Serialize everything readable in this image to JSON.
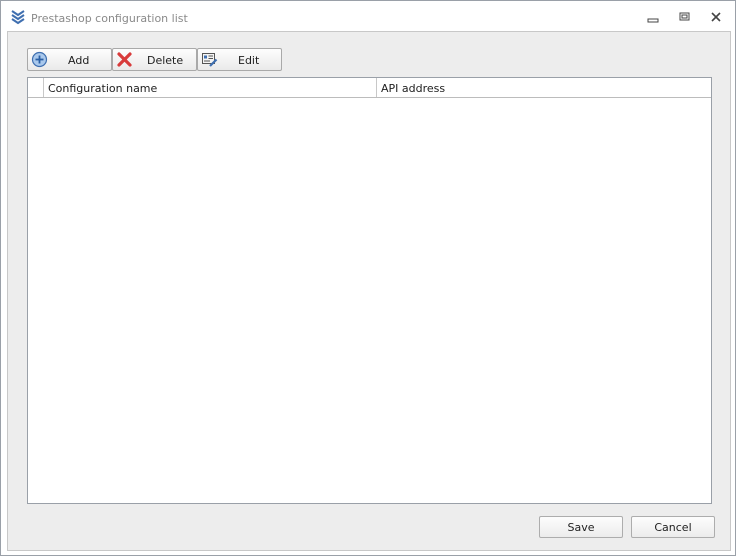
{
  "window": {
    "title": "Prestashop configuration list",
    "icon": "chevrons-down-logo-icon"
  },
  "window_controls": {
    "minimize": "minimize-icon",
    "restore": "restore-icon",
    "close": "close-icon"
  },
  "toolbar": {
    "add_label": "Add",
    "delete_label": "Delete",
    "edit_label": "Edit",
    "add_icon": "plus-circle-icon",
    "delete_icon": "red-x-icon",
    "edit_icon": "edit-document-icon"
  },
  "grid": {
    "columns": [
      "Configuration name",
      "API address"
    ],
    "rows": []
  },
  "footer": {
    "save_label": "Save",
    "cancel_label": "Cancel"
  },
  "colors": {
    "accent_blue": "#3f6fb0",
    "delete_red": "#d83b3b",
    "border": "#9aa0a8"
  }
}
